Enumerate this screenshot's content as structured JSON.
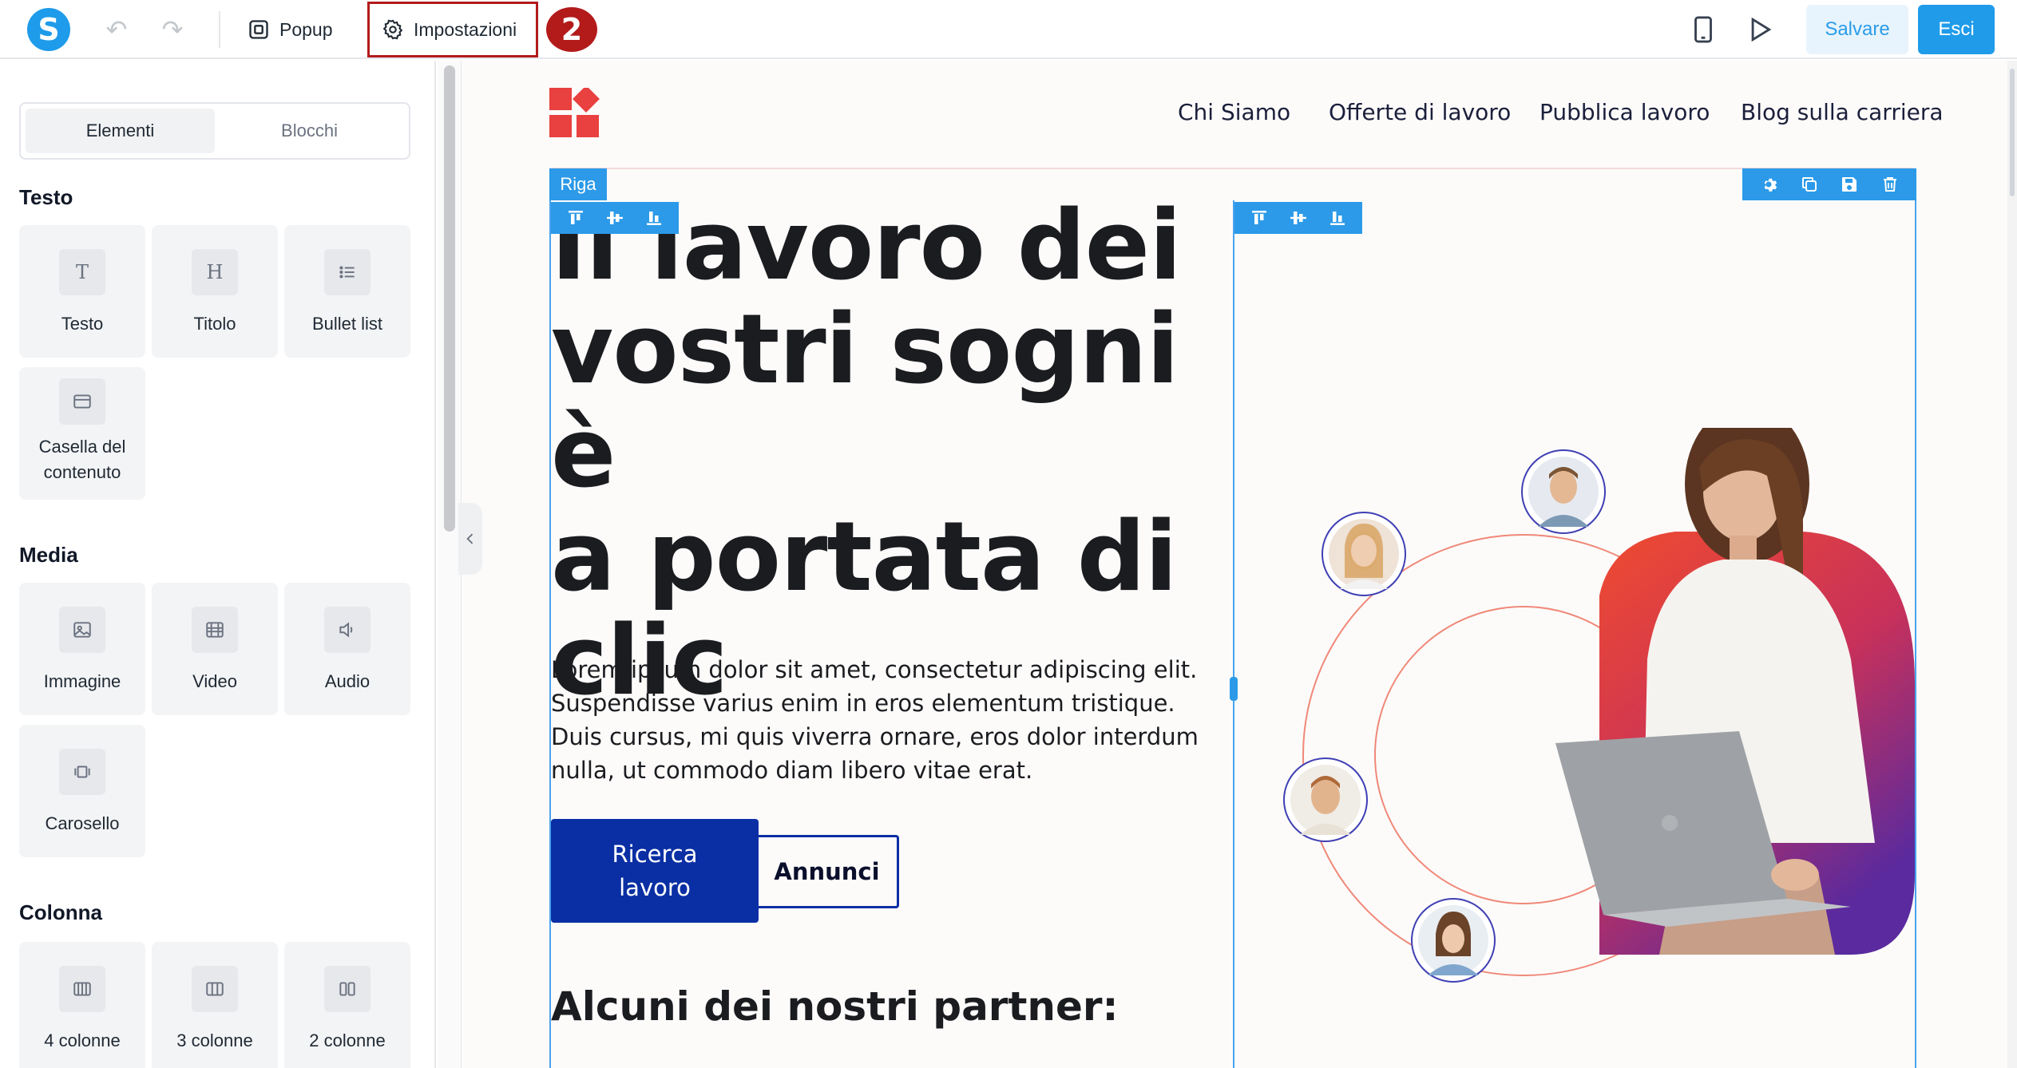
{
  "toolbar": {
    "logo_letter": "S",
    "popup_label": "Popup",
    "settings_label": "Impostazioni",
    "step_number": "2",
    "save_label": "Salvare",
    "exit_label": "Esci",
    "accent_color": "#1f9bea",
    "highlight_color": "#b31b1b"
  },
  "sidebar": {
    "tabs": [
      "Elementi",
      "Blocchi"
    ],
    "active_tab": "Elementi",
    "sections": {
      "testo": {
        "title": "Testo",
        "items": [
          "Testo",
          "Titolo",
          "Bullet list",
          "Casella del contenuto"
        ]
      },
      "media": {
        "title": "Media",
        "items": [
          "Immagine",
          "Video",
          "Audio",
          "Carosello"
        ]
      },
      "colonna": {
        "title": "Colonna",
        "items": [
          "4 colonne",
          "3 colonne",
          "2 colonne"
        ]
      }
    }
  },
  "canvas": {
    "nav": [
      "Chi Siamo",
      "Offerte di lavoro",
      "Pubblica lavoro",
      "Blog sulla carriera"
    ],
    "row_tag": "Riga",
    "hero_title_lines": [
      "Il lavoro dei",
      "vostri sogni è",
      "a portata di",
      "clic"
    ],
    "hero_description": "Lorem ipsum dolor sit amet, consectetur adipiscing elit. Suspendisse varius enim in eros elementum tristique. Duis cursus, mi quis viverra ornare, eros dolor interdum nulla, ut commodo diam libero vitae erat.",
    "primary_button_line1": "Ricerca",
    "primary_button_line2": "lavoro",
    "secondary_button": "Annunci",
    "partners_title": "Alcuni dei nostri partner:",
    "brand_color": "#0a2fa4",
    "logo_color": "#e8413f"
  }
}
